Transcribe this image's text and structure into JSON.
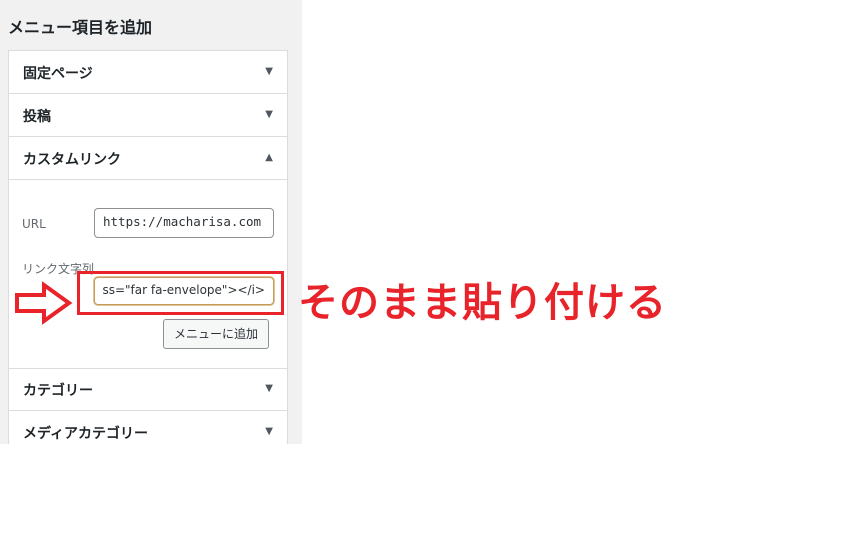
{
  "panel": {
    "title": "メニュー項目を追加",
    "sections": {
      "pages": {
        "label": "固定ページ"
      },
      "posts": {
        "label": "投稿"
      },
      "custom_links": {
        "label": "カスタムリンク",
        "url_label": "URL",
        "url_value": "https://macharisa.com",
        "link_text_label": "リンク文字列",
        "link_text_value": "ss=\"far fa-envelope\"></i>",
        "add_button_label": "メニューに追加"
      },
      "categories": {
        "label": "カテゴリー"
      },
      "media_categories": {
        "label": "メディアカテゴリー"
      }
    },
    "arrows": {
      "collapsed": "▼",
      "expanded": "▲"
    }
  },
  "annotation": {
    "text": "そのまま貼り付ける",
    "color": "#e8232a",
    "arrow_icon": "right-outline-arrow-icon"
  }
}
